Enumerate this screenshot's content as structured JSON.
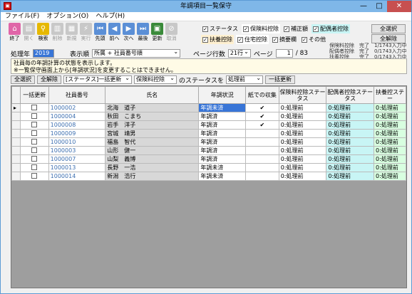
{
  "window": {
    "title": "年調項目一覧保守",
    "min": "—",
    "max": "□",
    "close": "✕"
  },
  "menu": [
    "ファイル(F)",
    "オプション(O)",
    "ヘルプ(H)"
  ],
  "toolbar": [
    {
      "label": "終了",
      "icon": "home-icon",
      "glyph": "⌂",
      "color": "#e066a8",
      "enabled": true
    },
    {
      "label": "開く",
      "icon": "open-icon",
      "glyph": "▤",
      "color": "#c8c8c8",
      "enabled": false
    },
    {
      "label": "検索",
      "icon": "search-icon",
      "glyph": "⚲",
      "color": "#e6b800",
      "enabled": true
    },
    {
      "label": "削除",
      "icon": "delete-icon",
      "glyph": "▥",
      "color": "#c8c8c8",
      "enabled": false
    },
    {
      "label": "新規",
      "icon": "new-icon",
      "glyph": "▦",
      "color": "#c8c8c8",
      "enabled": false
    },
    {
      "label": "実行",
      "icon": "run-icon",
      "glyph": "⚡",
      "color": "#c8c8c8",
      "enabled": false
    },
    {
      "label": "先頭",
      "icon": "first-icon",
      "glyph": "⏮",
      "color": "#5b8fd6",
      "enabled": true
    },
    {
      "label": "前へ",
      "icon": "prev-icon",
      "glyph": "◀",
      "color": "#5b8fd6",
      "enabled": true
    },
    {
      "label": "次へ",
      "icon": "next-icon",
      "glyph": "▶",
      "color": "#5b8fd6",
      "enabled": true
    },
    {
      "label": "最後",
      "icon": "last-icon",
      "glyph": "⏭",
      "color": "#5b8fd6",
      "enabled": true
    },
    {
      "label": "更新",
      "icon": "update-icon",
      "glyph": "▣",
      "color": "#3a8a3a",
      "enabled": true
    },
    {
      "label": "取消",
      "icon": "cancel-icon",
      "glyph": "⊘",
      "color": "#c8c8c8",
      "enabled": false
    }
  ],
  "options": {
    "row1": [
      {
        "label": "ステータス",
        "checked": true,
        "bg": "transparent"
      },
      {
        "label": "保険料控除",
        "checked": true,
        "bg": "#ffffff"
      },
      {
        "label": "補正額",
        "checked": true,
        "bg": "transparent"
      },
      {
        "label": "配偶者控除",
        "checked": true,
        "bg": "#c8f5f5"
      }
    ],
    "row2": [
      {
        "label": "扶養控除",
        "checked": true,
        "bg": "#fff0d0"
      },
      {
        "label": "住宅控除",
        "checked": true,
        "bg": "#ffffff"
      },
      {
        "label": "摘要欄",
        "checked": true,
        "bg": "transparent"
      },
      {
        "label": "その他",
        "checked": true,
        "bg": "transparent"
      }
    ]
  },
  "right_buttons": {
    "select_all": "全選択",
    "deselect_all": "全解除"
  },
  "status_lines": [
    "保険料控除　完了　1/1743入力中",
    "配偶者控除　完了　0/1743入力中",
    "扶養控除　　完了　0/1743入力中"
  ],
  "filter": {
    "year_label": "処理年",
    "year": "2019",
    "order_label": "表示順",
    "order": "所属 + 社員番号順",
    "rows_label": "ページ行数",
    "rows": "21行",
    "page_label": "ページ",
    "page": "1",
    "page_total": "/ 83"
  },
  "message": [
    "社員毎の年調計算の状態を表示します。",
    "※一覧保守画面上から[年調状況]を変更することはできません。"
  ],
  "bulk": {
    "select_all": "全選択",
    "deselect_all": "全解除",
    "status_bulk": "[ステータス]一括更新",
    "target": "保険料控除",
    "mid_text": "のステータスを",
    "state": "処理前",
    "update": "一括更新"
  },
  "columns": [
    "一括更新",
    "社員番号",
    "氏名",
    "年調状況",
    "紙での収集",
    "保険料控除ステータス",
    "配偶者控除ステータス",
    "扶養控ステー"
  ],
  "rows": [
    {
      "no": "1000002",
      "name": "北海　道子",
      "status": "年調未済",
      "paper": true,
      "s": "0:処理前"
    },
    {
      "no": "1000004",
      "name": "秋田　こまち",
      "status": "年調済",
      "paper": true,
      "s": "0:処理前"
    },
    {
      "no": "1000008",
      "name": "岩手　洋子",
      "status": "年調済",
      "paper": true,
      "s": "0:処理前"
    },
    {
      "no": "1000009",
      "name": "宮城　靖男",
      "status": "年調済",
      "paper": false,
      "s": "0:処理前"
    },
    {
      "no": "1000010",
      "name": "福島　智代",
      "status": "年調済",
      "paper": false,
      "s": "0:処理前"
    },
    {
      "no": "1000003",
      "name": "山形　健一",
      "status": "年調済",
      "paper": false,
      "s": "0:処理前"
    },
    {
      "no": "1000007",
      "name": "山梨　義博",
      "status": "年調済",
      "paper": false,
      "s": "0:処理前"
    },
    {
      "no": "1000013",
      "name": "長野　一浩",
      "status": "年調未済",
      "paper": false,
      "s": "0:処理前"
    },
    {
      "no": "1000014",
      "name": "新潟　浩行",
      "status": "年調未済",
      "paper": false,
      "s": "0:処理前"
    }
  ]
}
